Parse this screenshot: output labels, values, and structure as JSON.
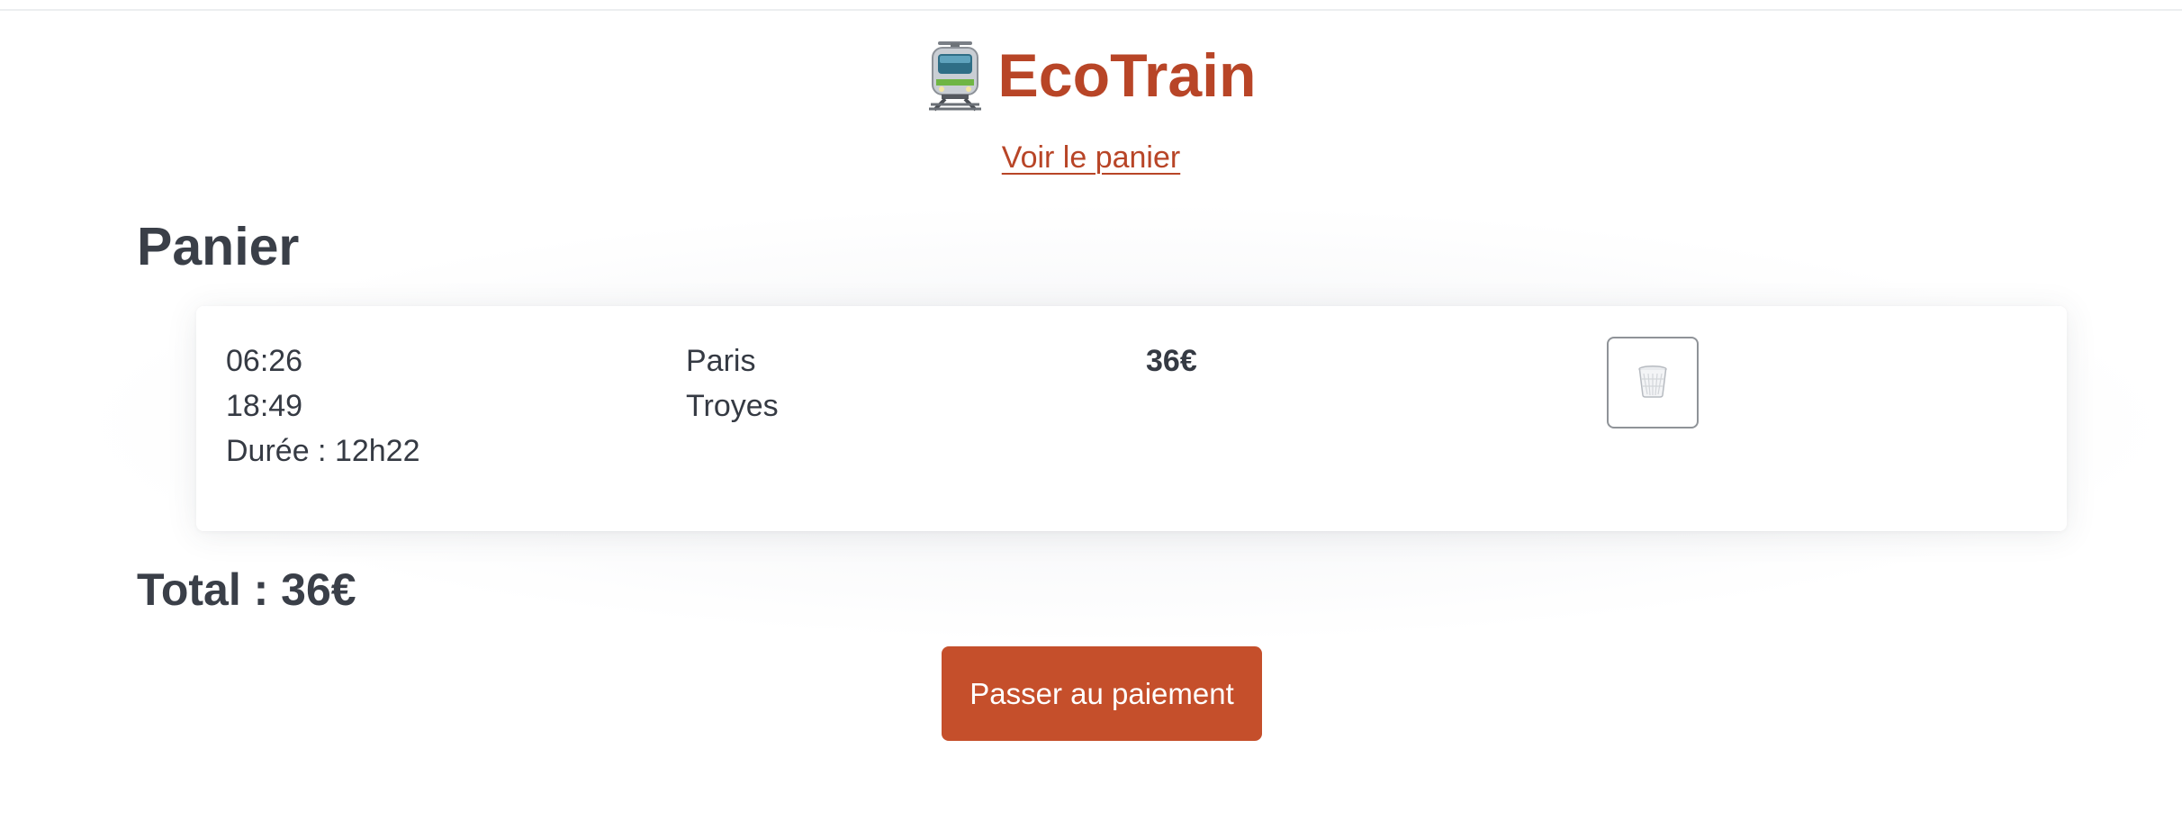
{
  "header": {
    "brand_name": "EcoTrain",
    "brand_icon": "tram-icon",
    "cart_link_label": "Voir le panier",
    "accent_color": "#b84527"
  },
  "cart": {
    "title": "Panier",
    "items": [
      {
        "departure_time": "06:26",
        "arrival_time": "18:49",
        "duration": "Durée : 12h22",
        "origin": "Paris",
        "destination": "Troyes",
        "price": "36€",
        "delete_icon": "trash-icon"
      }
    ],
    "total": "Total : 36€",
    "pay_button_label": "Passer au paiement",
    "pay_button_color": "#c54f2b"
  }
}
